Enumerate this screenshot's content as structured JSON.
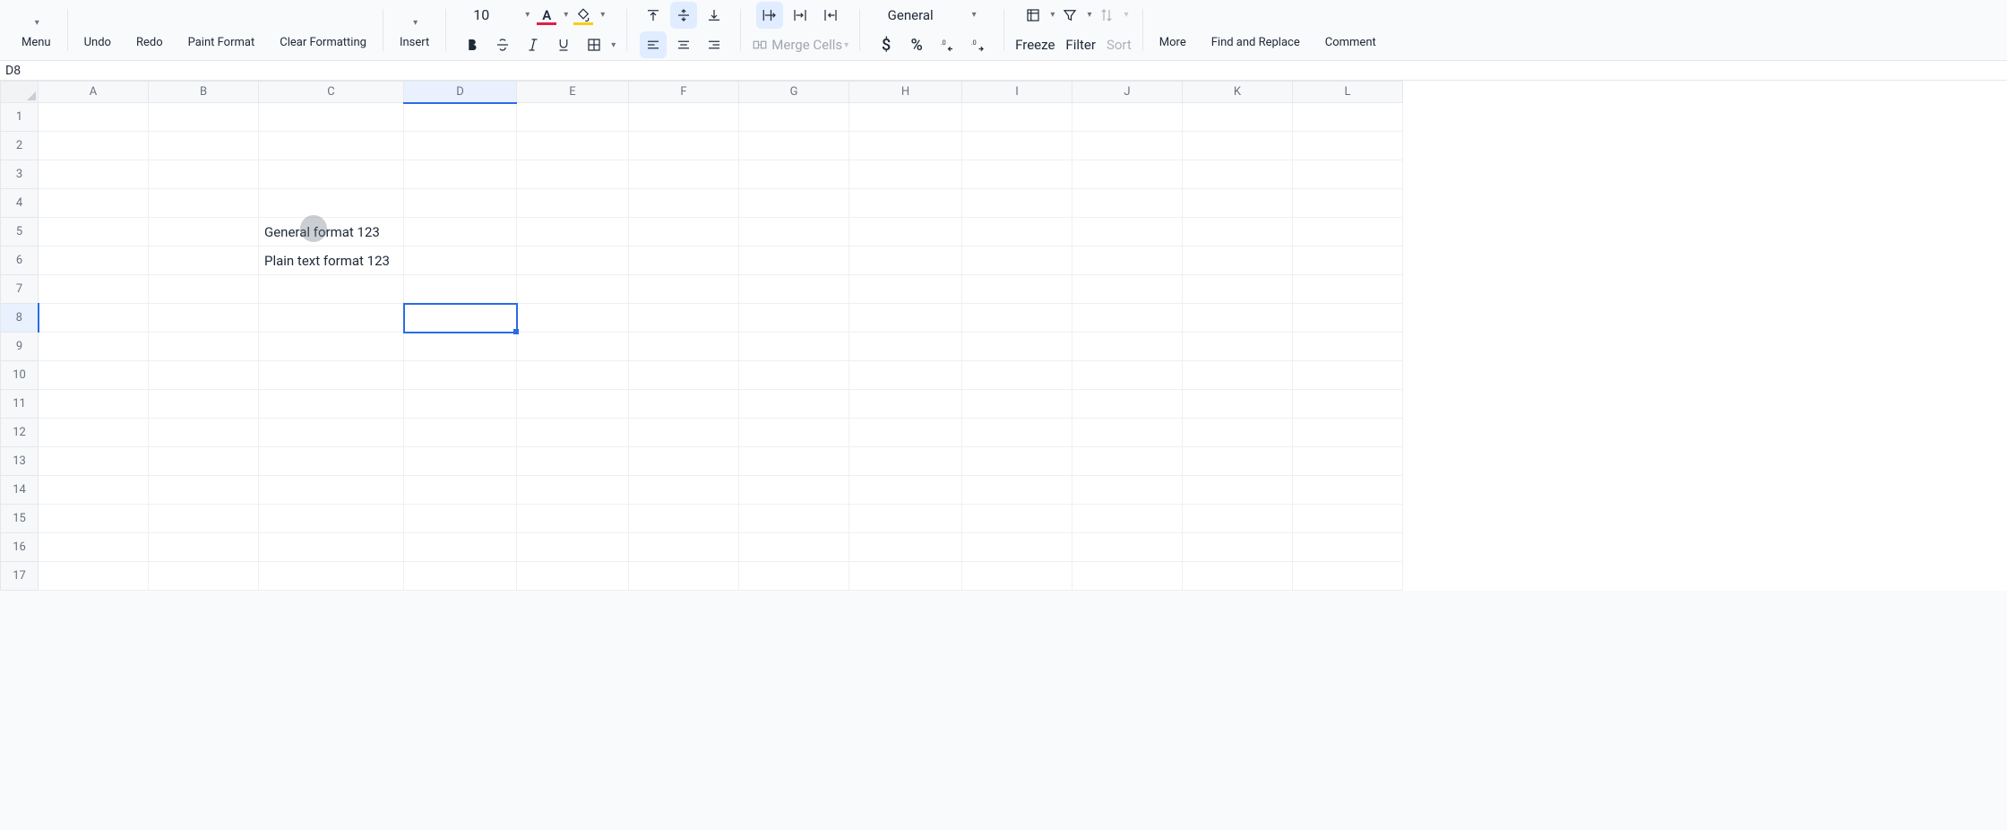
{
  "toolbar": {
    "menu_label": "Menu",
    "undo_label": "Undo",
    "redo_label": "Redo",
    "paint_format_label": "Paint Format",
    "clear_formatting_label": "Clear Formatting",
    "insert_label": "Insert",
    "font_size": "10",
    "font_color_glyph": "A",
    "number_format_selected": "General",
    "merge_cells_label": "Merge Cells",
    "freeze_label": "Freeze",
    "filter_label": "Filter",
    "sort_label": "Sort",
    "more_label": "More",
    "find_replace_label": "Find and Replace",
    "comment_label": "Comment"
  },
  "namebox": {
    "active_cell": "D8"
  },
  "columns": [
    "A",
    "B",
    "C",
    "D",
    "E",
    "F",
    "G",
    "H",
    "I",
    "J",
    "K",
    "L"
  ],
  "rows": [
    1,
    2,
    3,
    4,
    5,
    6,
    7,
    8,
    9,
    10,
    11,
    12,
    13,
    14,
    15,
    16,
    17
  ],
  "cells": {
    "C5": "General format 123",
    "C6": "Plain text format 123"
  },
  "selection": {
    "col": "D",
    "row": 8
  },
  "cursor_indicator": {
    "near_cell": "C5"
  }
}
